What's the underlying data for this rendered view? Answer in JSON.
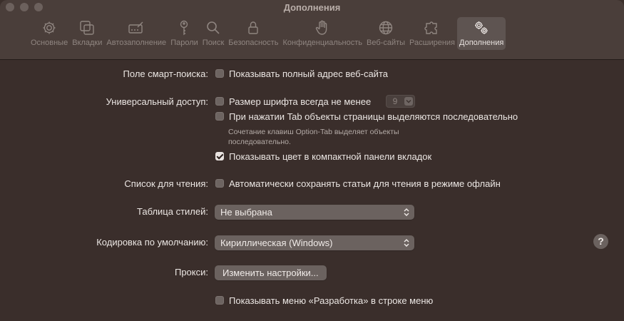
{
  "window": {
    "title": "Дополнения"
  },
  "toolbar": {
    "tabs": [
      {
        "label": "Основные",
        "icon": "gear-icon",
        "active": false
      },
      {
        "label": "Вкладки",
        "icon": "tabs-icon",
        "active": false
      },
      {
        "label": "Автозаполнение",
        "icon": "autofill-icon",
        "active": false
      },
      {
        "label": "Пароли",
        "icon": "key-icon",
        "active": false
      },
      {
        "label": "Поиск",
        "icon": "search-icon",
        "active": false
      },
      {
        "label": "Безопасность",
        "icon": "lock-icon",
        "active": false
      },
      {
        "label": "Конфиденциальность",
        "icon": "hand-icon",
        "active": false
      },
      {
        "label": "Веб-сайты",
        "icon": "globe-icon",
        "active": false
      },
      {
        "label": "Расширения",
        "icon": "puzzle-icon",
        "active": false
      },
      {
        "label": "Дополнения",
        "icon": "gears-icon",
        "active": true
      }
    ]
  },
  "settings": {
    "smart_search": {
      "label": "Поле смарт-поиска:",
      "show_full_address": {
        "text": "Показывать полный адрес веб-сайта",
        "checked": false
      }
    },
    "accessibility": {
      "label": "Универсальный доступ:",
      "min_font": {
        "text": "Размер шрифта всегда не менее",
        "checked": false,
        "value": "9"
      },
      "tab_highlight": {
        "text": "При нажатии Tab объекты страницы выделяются последовательно",
        "checked": false
      },
      "tab_note": "Сочетание клавиш Option-Tab выделяет объекты последовательно.",
      "compact_color": {
        "text": "Показывать цвет в компактной панели вкладок",
        "checked": true
      }
    },
    "reading_list": {
      "label": "Список для чтения:",
      "save_offline": {
        "text": "Автоматически сохранять статьи для чтения в режиме офлайн",
        "checked": false
      }
    },
    "stylesheet": {
      "label": "Таблица стилей:",
      "value": "Не выбрана"
    },
    "encoding": {
      "label": "Кодировка по умолчанию:",
      "value": "Кириллическая (Windows)"
    },
    "proxies": {
      "label": "Прокси:",
      "button": "Изменить настройки..."
    },
    "develop_menu": {
      "text": "Показывать меню «Разработка» в строке меню",
      "checked": false
    }
  },
  "help": {
    "glyph": "?"
  }
}
